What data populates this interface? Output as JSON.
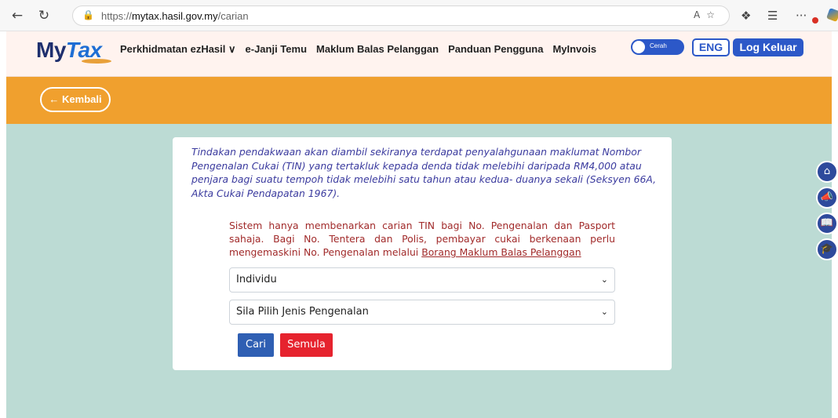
{
  "browser": {
    "url_prefix": "https://",
    "url_host": "mytax.hasil.gov.my",
    "url_path": "/carian"
  },
  "header": {
    "logo_my": "My",
    "logo_tax": "Tax",
    "nav": [
      {
        "label": "Perkhidmatan ezHasil ∨"
      },
      {
        "label": "e-Janji Temu"
      },
      {
        "label": "Maklum Balas Pelanggan"
      },
      {
        "label": "Panduan Pengguna"
      },
      {
        "label": "MyInvois"
      }
    ],
    "theme_label": "Cerah",
    "lang_label": "ENG",
    "logout_label": "Log Keluar"
  },
  "band": {
    "back_label": "← Kembali"
  },
  "card": {
    "warning": "Tindakan pendakwaan akan diambil sekiranya terdapat penyalahgunaan maklumat Nombor Pengenalan Cukai (TIN) yang tertakluk kepada denda tidak melebihi daripada RM4,000 atau penjara bagi suatu tempoh tidak melebihi satu tahun atau kedua- duanya sekali (Seksyen 66A, Akta Cukai Pendapatan 1967).",
    "notice_text": "Sistem hanya membenarkan carian TIN bagi No. Pengenalan dan Pasport sahaja. Bagi No. Tentera dan Polis, pembayar cukai berkenaan perlu mengemaskini No. Pengenalan melalui ",
    "notice_link": "Borang Maklum Balas Pelanggan",
    "select_type": "Individu",
    "select_id": "Sila Pilih Jenis Pengenalan",
    "search_label": "Cari",
    "reset_label": "Semula"
  },
  "colors": {
    "brand_blue": "#2c58c8",
    "band_orange": "#f0a02e",
    "page_bg": "#bcdbd4",
    "warning_text": "#3a3a9e",
    "notice_text": "#a12a2a",
    "search_btn": "#2f5fb3",
    "reset_btn": "#e6232e"
  },
  "icons": {
    "side_buttons": [
      "home-icon",
      "megaphone-icon",
      "book-icon",
      "graduation-cap-icon"
    ]
  }
}
